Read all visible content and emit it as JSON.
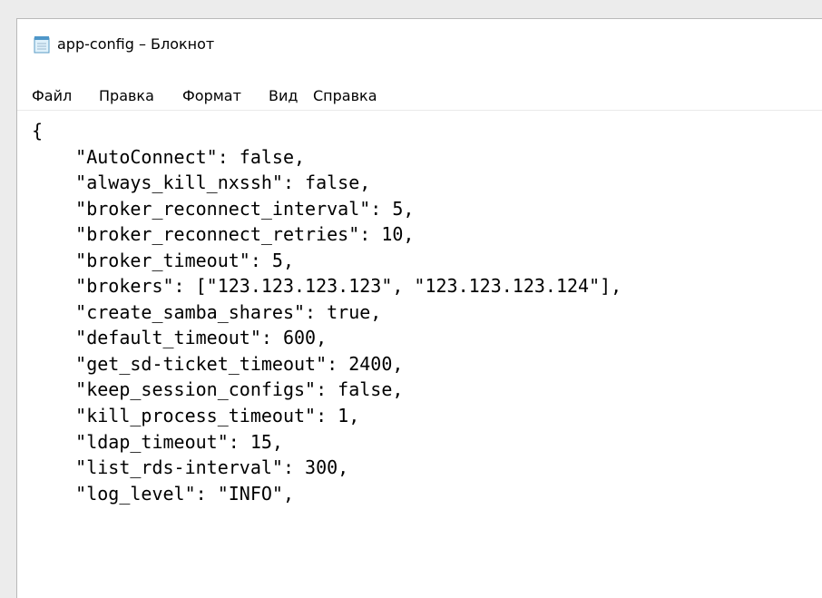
{
  "window": {
    "title": "app-config – Блокнот",
    "icon": "notepad-icon"
  },
  "menu": {
    "items": [
      {
        "label": "Файл"
      },
      {
        "label": "Правка"
      },
      {
        "label": "Формат"
      },
      {
        "label": "Вид"
      },
      {
        "label": "Справка"
      }
    ]
  },
  "editor": {
    "lines": [
      "{",
      "    \"AutoConnect\": false,",
      "    \"always_kill_nxssh\": false,",
      "    \"broker_reconnect_interval\": 5,",
      "    \"broker_reconnect_retries\": 10,",
      "    \"broker_timeout\": 5,",
      "    \"brokers\": [\"123.123.123.123\", \"123.123.123.124\"],",
      "    \"create_samba_shares\": true,",
      "    \"default_timeout\": 600,",
      "    \"get_sd-ticket_timeout\": 2400,",
      "    \"keep_session_configs\": false,",
      "    \"kill_process_timeout\": 1,",
      "    \"ldap_timeout\": 15,",
      "    \"list_rds-interval\": 300,",
      "    \"log_level\": \"INFO\","
    ]
  }
}
